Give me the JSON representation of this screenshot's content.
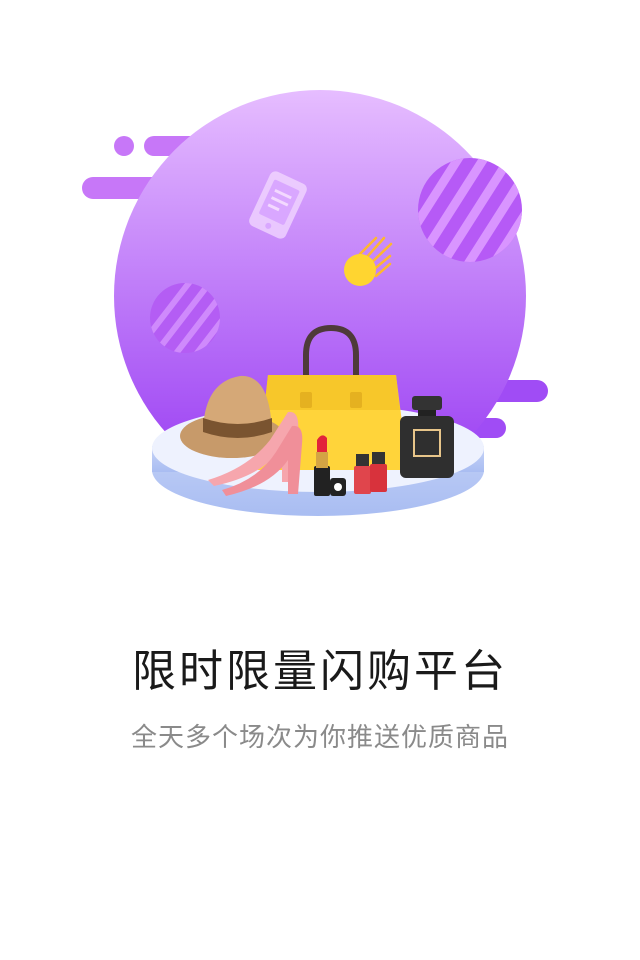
{
  "onboarding": {
    "title": "限时限量闪购平台",
    "subtitle": "全天多个场次为你推送优质商品"
  },
  "illustration": {
    "icons": [
      "phone-icon",
      "meteor-icon",
      "hat-icon",
      "handbag-icon",
      "high-heel-icon",
      "lipstick-icon",
      "nail-polish-icon",
      "perfume-icon"
    ]
  },
  "colors": {
    "circle_top": "#e4b8ff",
    "circle_bottom": "#9b3bf5",
    "accent_yellow": "#ffd530",
    "platform_top": "#eef3ff",
    "platform_side": "#b9c9f5",
    "title_text": "#1a1a1a",
    "subtitle_text": "#8a8a8a"
  }
}
